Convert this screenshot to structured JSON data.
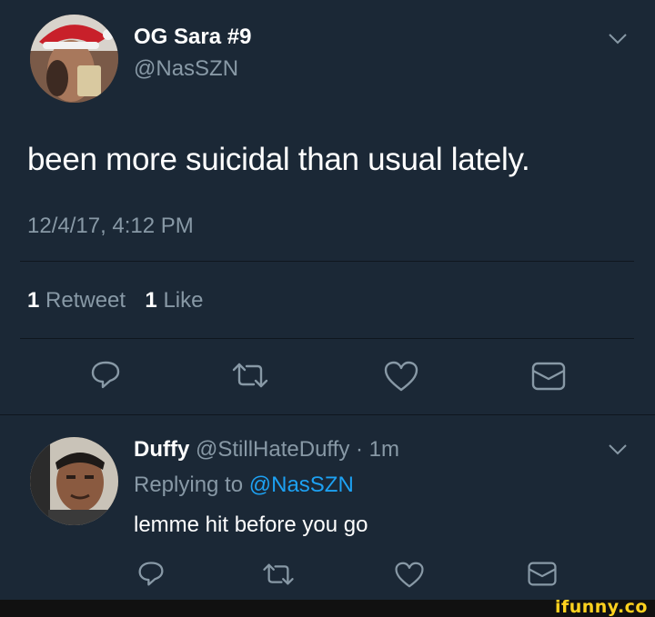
{
  "tweet": {
    "author_name": "OG Sara #9",
    "handle": "@NasSZN",
    "text": "been more suicidal than usual lately.",
    "timestamp": "12/4/17, 4:12 PM",
    "retweet_count": "1",
    "retweet_label": "Retweet",
    "like_count": "1",
    "like_label": "Like"
  },
  "reply": {
    "author_name": "Duffy",
    "handle_time": "@StillHateDuffy · 1m",
    "replying_prefix": "Replying to",
    "replying_handle": "@NasSZN",
    "text": "lemme hit before you go"
  },
  "icons": {
    "reply": "reply-icon",
    "retweet": "retweet-icon",
    "like": "heart-icon",
    "dm": "envelope-icon",
    "menu": "chevron-down-icon"
  },
  "colors": {
    "background": "#1b2836",
    "muted": "#8899a6",
    "link": "#1da1f2",
    "watermark": "#ffd21f"
  },
  "watermark": "ifunny.co"
}
